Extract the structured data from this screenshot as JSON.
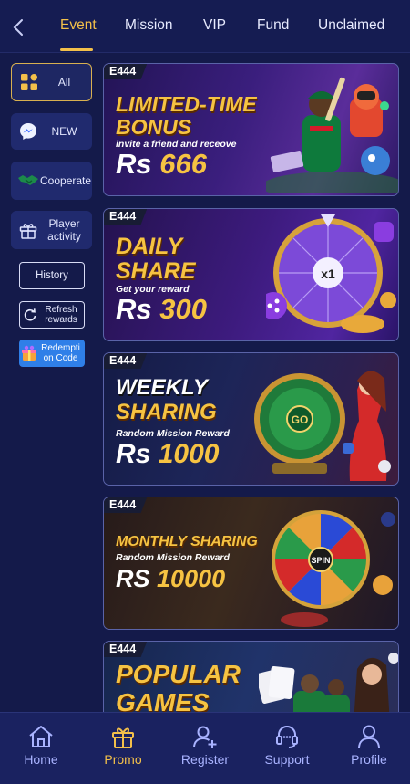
{
  "tabs": [
    {
      "label": "Event",
      "active": true
    },
    {
      "label": "Mission"
    },
    {
      "label": "VIP"
    },
    {
      "label": "Fund"
    },
    {
      "label": "Unclaimed"
    }
  ],
  "sidebar": {
    "items": [
      {
        "label": "All",
        "icon": "grid-icon",
        "active": true
      },
      {
        "label": "NEW",
        "icon": "messenger-icon"
      },
      {
        "label": "Cooperate",
        "icon": "handshake-icon"
      },
      {
        "label": "Player activity",
        "icon": "gift-icon"
      }
    ],
    "history_label": "History",
    "refresh_label": "Refresh rewards",
    "redeem_label": "Redempti on Code"
  },
  "banners": [
    {
      "logo": "E444",
      "headline_1": "LIMITED-TIME",
      "headline_2": "BONUS",
      "sub": "invite a friend and receove",
      "currency": "Rs",
      "amount": "666"
    },
    {
      "logo": "E444",
      "headline_1": "DAILY",
      "headline_2": "SHARE",
      "sub": "Get your reward",
      "currency": "Rs",
      "amount": "300",
      "wheel_center": "x1"
    },
    {
      "logo": "E444",
      "headline_1": "WEEKLY",
      "headline_2": "SHARING",
      "sub": "Random Mission Reward",
      "currency": "Rs",
      "amount": "1000",
      "wheel_center": "GO"
    },
    {
      "logo": "E444",
      "headline_1": "MONTHLY SHARING",
      "sub": "Random Mission Reward",
      "currency": "RS",
      "amount": "10000",
      "wheel_center": "SPIN"
    },
    {
      "logo": "E444",
      "headline_1": "POPULAR",
      "headline_2": "GAMES"
    }
  ],
  "bottom_nav": [
    {
      "label": "Home",
      "icon": "home-icon"
    },
    {
      "label": "Promo",
      "icon": "gift-icon",
      "active": true
    },
    {
      "label": "Register",
      "icon": "add-user-icon"
    },
    {
      "label": "Support",
      "icon": "headset-icon"
    },
    {
      "label": "Profile",
      "icon": "profile-icon"
    }
  ],
  "colors": {
    "background": "#141a4a",
    "accent": "#f3c04a",
    "nav_inactive": "#a9b3ff",
    "redeem_button": "#2f7fe8"
  }
}
